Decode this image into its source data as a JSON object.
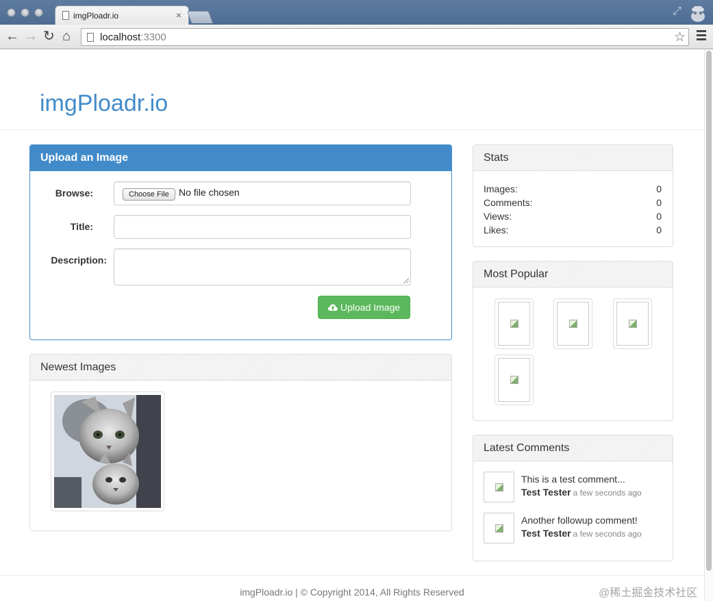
{
  "browser": {
    "tab_title": "imgPloadr.io",
    "tab_close": "×",
    "url_host": "localhost",
    "url_port": ":3300",
    "back_glyph": "←",
    "forward_glyph": "→",
    "reload_glyph": "↻",
    "home_glyph": "⌂",
    "star_glyph": "☆",
    "resize_glyph": "⤢"
  },
  "brand": "imgPloadr.io",
  "upload": {
    "heading": "Upload an Image",
    "browse_label": "Browse:",
    "choose_file": "Choose File",
    "file_status": "No file chosen",
    "title_label": "Title:",
    "description_label": "Description:",
    "submit_label": "Upload Image"
  },
  "newest": {
    "heading": "Newest Images"
  },
  "stats": {
    "heading": "Stats",
    "rows": [
      {
        "label": "Images:",
        "value": "0"
      },
      {
        "label": "Comments:",
        "value": "0"
      },
      {
        "label": "Views:",
        "value": "0"
      },
      {
        "label": "Likes:",
        "value": "0"
      }
    ]
  },
  "popular": {
    "heading": "Most Popular"
  },
  "comments": {
    "heading": "Latest Comments",
    "items": [
      {
        "text": "This is a test comment...",
        "author": "Test Tester",
        "time": "a few seconds ago"
      },
      {
        "text": "Another followup comment!",
        "author": "Test Tester",
        "time": "a few seconds ago"
      }
    ]
  },
  "footer": "imgPloadr.io | © Copyright 2014, All Rights Reserved",
  "watermark": "@稀土掘金技术社区",
  "colors": {
    "primary": "#428bca",
    "success": "#5cb85c",
    "titlebar": "#5677a0"
  }
}
